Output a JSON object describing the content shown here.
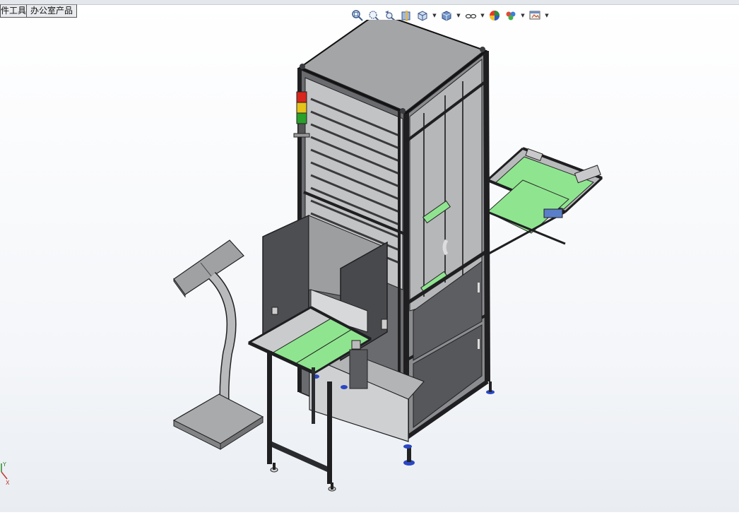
{
  "tabs": [
    {
      "label": "件工具"
    },
    {
      "label": "办公室产品"
    }
  ],
  "toolbar": {
    "icons": [
      "zoom-to-fit-icon",
      "zoom-to-area-icon",
      "previous-view-icon",
      "section-view-icon",
      "view-orientation-icon",
      "display-style-icon",
      "hide-show-items-icon",
      "edit-appearance-icon",
      "apply-scene-icon",
      "view-settings-icon"
    ]
  },
  "model": {
    "stack_light_colors": [
      "#d8261c",
      "#e6c31a",
      "#29a12a"
    ],
    "conveyor_color": "#8fe58f",
    "frame_color": "#2e2f33",
    "panel_color": "#8d8d8f"
  },
  "triad": {
    "axes": [
      "Y",
      "X"
    ]
  }
}
